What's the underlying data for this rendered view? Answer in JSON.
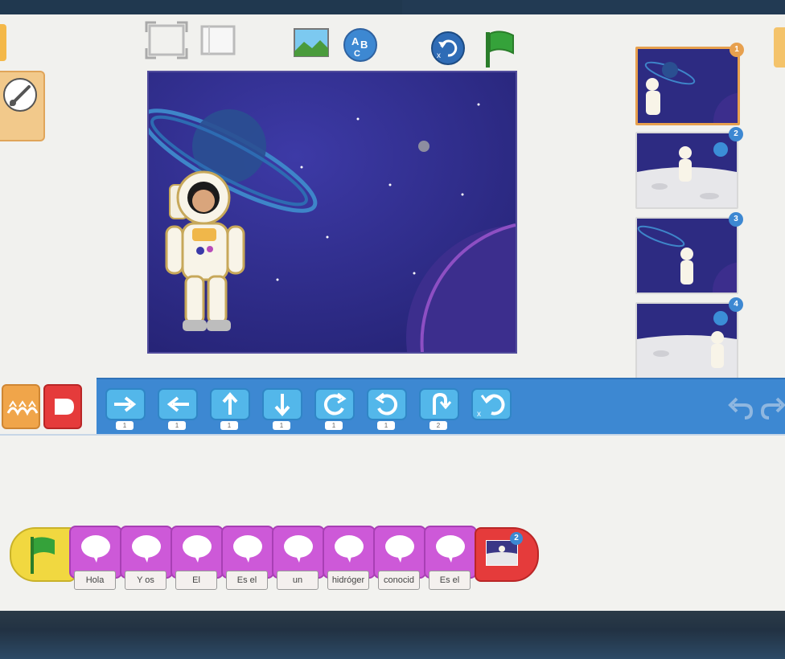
{
  "colors": {
    "accent_blue": "#3d88d2",
    "motion_blue": "#53b7ea",
    "looks_purple": "#cd59d8",
    "trigger_yellow": "#f1d840",
    "end_red": "#e53b3b",
    "trigger_orange": "#f0a54a",
    "stage_bg": "#2d2b82",
    "selected_border": "#e7a04e"
  },
  "toolbar": {
    "icons": [
      "fullscreen-icon",
      "grid-icon",
      "background-icon",
      "text-icon",
      "reset-icon",
      "green-flag-icon"
    ]
  },
  "pages": [
    {
      "number": "1",
      "scene": "space",
      "selected": true
    },
    {
      "number": "2",
      "scene": "moon",
      "selected": false
    },
    {
      "number": "3",
      "scene": "space",
      "selected": false
    },
    {
      "number": "4",
      "scene": "moon",
      "selected": false
    }
  ],
  "palette": {
    "categories": [
      "triggers-category",
      "end-category"
    ],
    "blocks": [
      {
        "name": "move-right",
        "count": "1"
      },
      {
        "name": "move-left",
        "count": "1"
      },
      {
        "name": "move-up",
        "count": "1"
      },
      {
        "name": "move-down",
        "count": "1"
      },
      {
        "name": "turn-right",
        "count": "1"
      },
      {
        "name": "turn-left",
        "count": "1"
      },
      {
        "name": "hop",
        "count": "2"
      },
      {
        "name": "go-home",
        "count": ""
      }
    ]
  },
  "script": {
    "say_labels": [
      "Hola",
      "Y os",
      "El",
      "Es el",
      "un",
      "hidróger",
      "conocid",
      "Es el"
    ],
    "go_to_page": "2"
  }
}
